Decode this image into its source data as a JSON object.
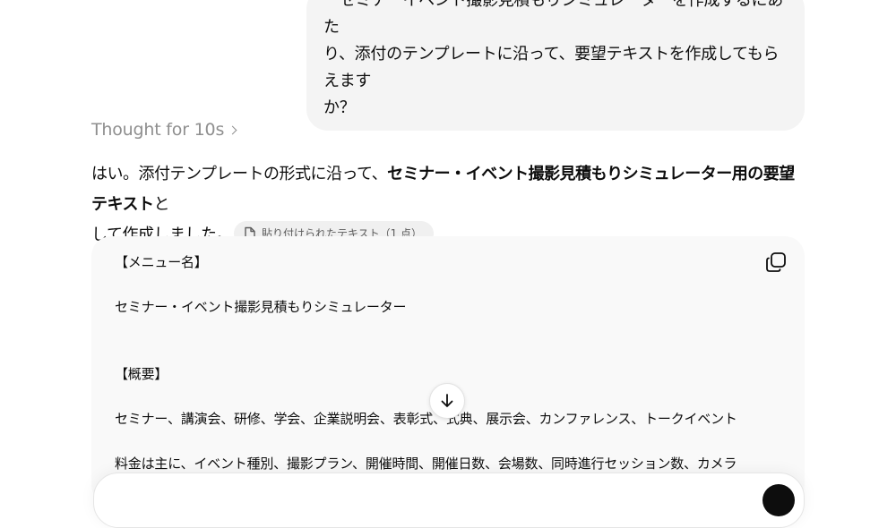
{
  "user_message": {
    "lines": [
      "ーセミナーイベント撮影見積もりシミュレーターを作成するにあた",
      "り、添付のテンプレートに沿って、要望テキストを作成してもらえます",
      "か？"
    ]
  },
  "thought": {
    "label": "Thought for 10s"
  },
  "reply": {
    "part1": "はい。添付テンプレートの形式に沿って、",
    "bold": "セミナー・イベント撮影見積もりシミュレーター用の要望テキスト",
    "part2": "と",
    "part3": "して作成しました。",
    "attachment_label": "貼り付けられたテキスト（1 点）"
  },
  "code_block": {
    "lines": [
      "【メニュー名】",
      "セミナー・イベント撮影見積もりシミュレーター",
      "【概要】",
      "セミナー、講演会、研修、学会、企業説明会、表彰式、式典、展示会、カンファレンス、トークイベント",
      "料金は主に、イベント種別、撮影プラン、開催時間、開催日数、会場数、同時進行セッション数、カメラ"
    ]
  },
  "icons": {
    "copy": "copy-icon",
    "file": "file-icon",
    "chevron": "chevron-right-icon",
    "scroll": "arrow-down-icon"
  },
  "colors": {
    "user_bubble": "#f4f4f4",
    "code_bg": "#f9f9f9",
    "muted_text": "#8f8f8f",
    "send_button": "#0d0d0d"
  }
}
